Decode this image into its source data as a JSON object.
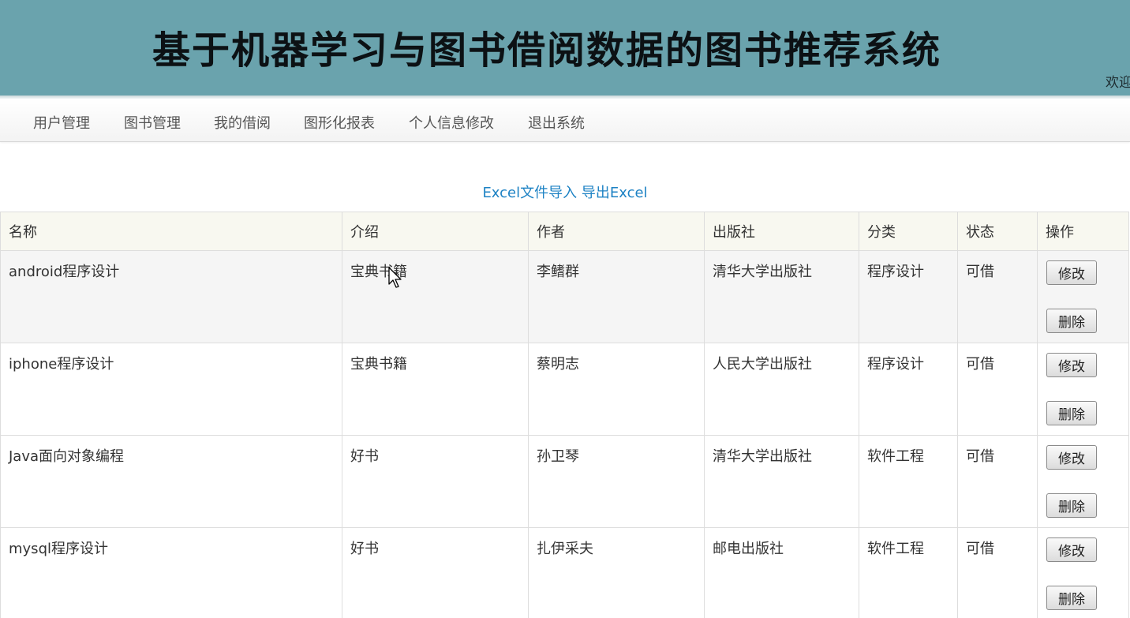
{
  "header": {
    "title": "基于机器学习与图书借阅数据的图书推荐系统",
    "welcome": "欢迎"
  },
  "nav": {
    "items": [
      {
        "label": "用户管理"
      },
      {
        "label": "图书管理"
      },
      {
        "label": "我的借阅"
      },
      {
        "label": "图形化报表"
      },
      {
        "label": "个人信息修改"
      },
      {
        "label": "退出系统"
      }
    ]
  },
  "excel": {
    "import_label": "Excel文件导入",
    "export_label": "导出Excel"
  },
  "table": {
    "columns": [
      "名称",
      "介绍",
      "作者",
      "出版社",
      "分类",
      "状态",
      "操作"
    ],
    "rows": [
      {
        "name": "android程序设计",
        "intro": "宝典书籍",
        "author": "李鳍群",
        "publisher": "清华大学出版社",
        "category": "程序设计",
        "status": "可借"
      },
      {
        "name": "iphone程序设计",
        "intro": "宝典书籍",
        "author": "蔡明志",
        "publisher": "人民大学出版社",
        "category": "程序设计",
        "status": "可借"
      },
      {
        "name": "Java面向对象编程",
        "intro": "好书",
        "author": "孙卫琴",
        "publisher": "清华大学出版社",
        "category": "软件工程",
        "status": "可借"
      },
      {
        "name": "mysql程序设计",
        "intro": "好书",
        "author": "扎伊采夫",
        "publisher": "邮电出版社",
        "category": "软件工程",
        "status": "可借"
      }
    ],
    "edit_label": "修改",
    "delete_label": "删除"
  },
  "colors": {
    "banner": "#6aa3ad",
    "link": "#1d82c4",
    "header_row": "#f8f8f0"
  }
}
